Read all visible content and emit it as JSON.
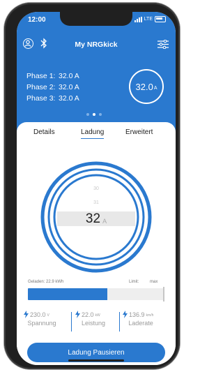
{
  "status_bar": {
    "time": "12:00",
    "network": "LTE"
  },
  "header": {
    "title": "My NRGkick"
  },
  "phases": [
    {
      "label": "Phase  1:",
      "value": "32.0 A"
    },
    {
      "label": "Phase  2:",
      "value": "32.0 A"
    },
    {
      "label": "Phase  3:",
      "value": "32.0 A"
    }
  ],
  "current_ring": {
    "value": "32.0",
    "unit": "A"
  },
  "tabs": [
    {
      "label": "Details",
      "active": false
    },
    {
      "label": "Ladung",
      "active": true
    },
    {
      "label": "Erweitert",
      "active": false
    }
  ],
  "dial": {
    "scale_above_1": "30",
    "scale_above_2": "31",
    "value": "32",
    "unit": "A"
  },
  "charging": {
    "charged_label": "Geladen: 22.9 kWh",
    "limit_label": "Limit:",
    "limit_value": "max",
    "progress_fraction": 0.58
  },
  "stats": [
    {
      "value": "230.0",
      "unit": "V",
      "label": "Spannung"
    },
    {
      "value": "22.0",
      "unit": "kW",
      "label": "Leistung"
    },
    {
      "value": "136.9",
      "unit": "km/h",
      "label": "Laderate"
    }
  ],
  "actions": {
    "pause_label": "Ladung Pausieren"
  },
  "colors": {
    "accent": "#2a79cf"
  }
}
